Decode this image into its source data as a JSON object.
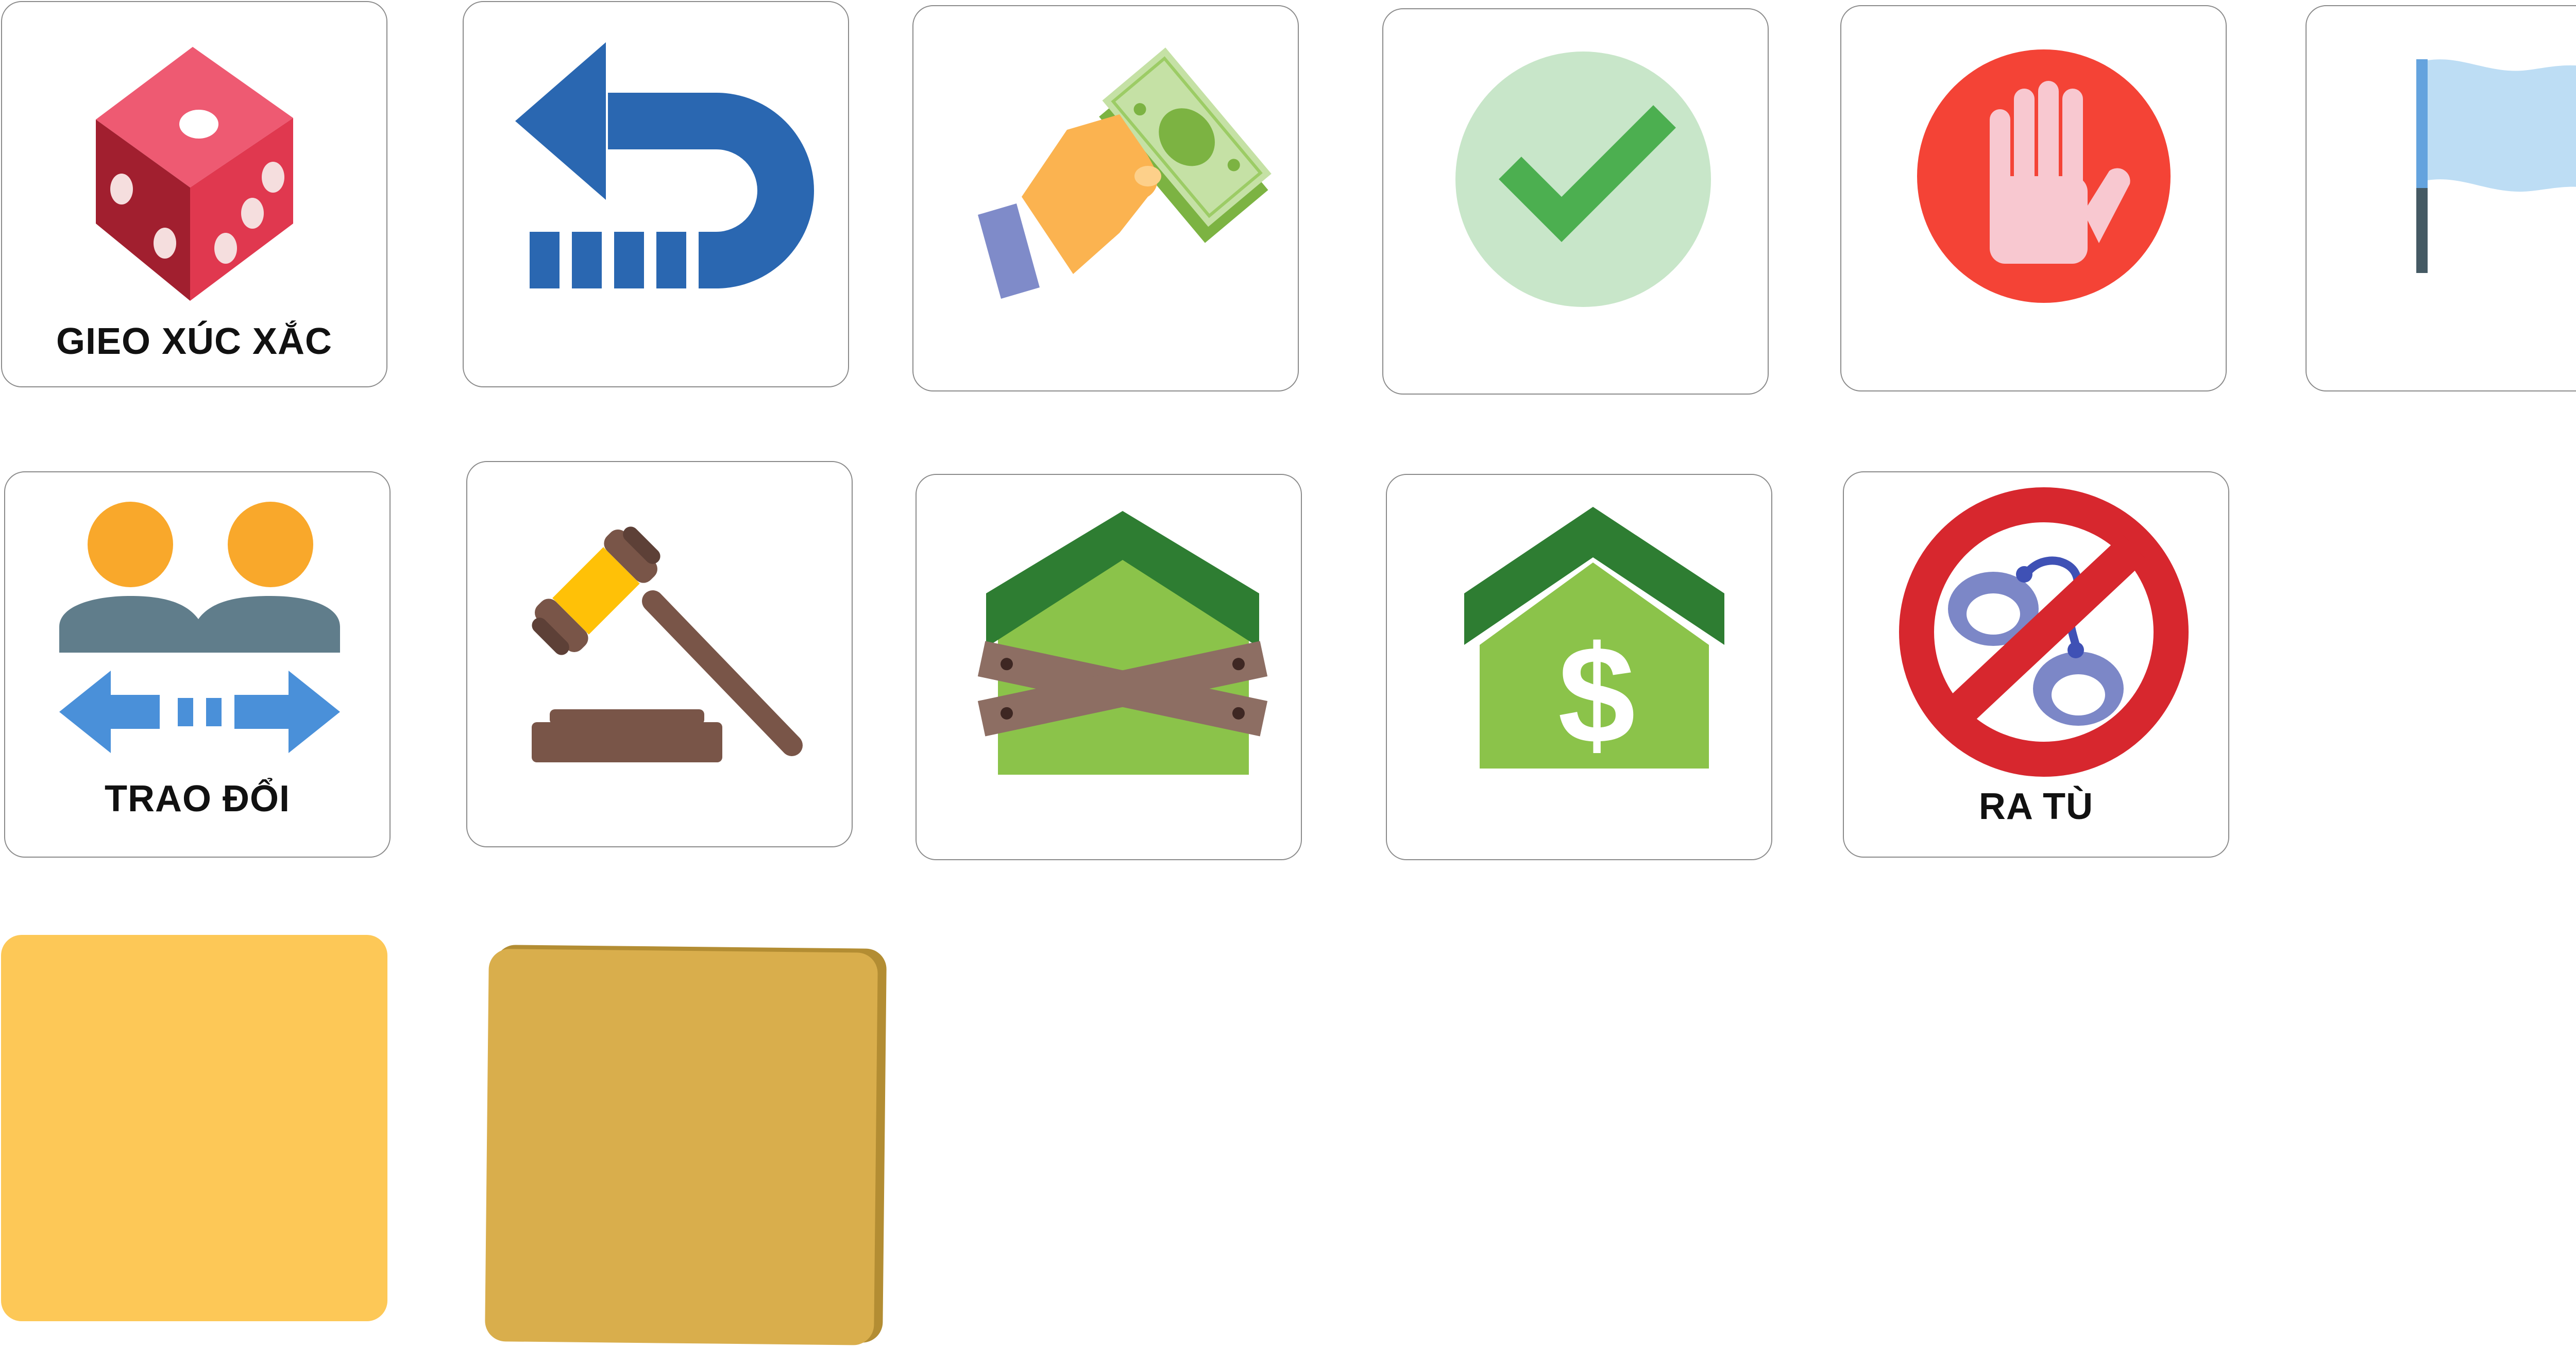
{
  "tiles": [
    {
      "id": "roll-dice",
      "label": "GIEO XÚC XẮC",
      "icon": "dice-icon"
    },
    {
      "id": "go-back",
      "label": "",
      "icon": "u-turn-back-arrow-icon"
    },
    {
      "id": "pay-money",
      "label": "",
      "icon": "hand-giving-money-icon"
    },
    {
      "id": "confirm",
      "label": "",
      "icon": "checkmark-icon"
    },
    {
      "id": "stop",
      "label": "",
      "icon": "stop-hand-icon"
    },
    {
      "id": "flag",
      "label": "",
      "icon": "flag-icon"
    },
    {
      "id": "trade",
      "label": "TRAO ĐỔI",
      "icon": "two-people-exchange-icon"
    },
    {
      "id": "auction",
      "label": "",
      "icon": "gavel-icon"
    },
    {
      "id": "mortgage",
      "label": "",
      "icon": "boarded-house-icon"
    },
    {
      "id": "sell-house",
      "label": "",
      "icon": "house-dollar-icon"
    },
    {
      "id": "leave-jail",
      "label": "RA TÙ",
      "icon": "no-handcuffs-icon"
    }
  ],
  "blank_cards": [
    {
      "id": "yellow-card",
      "color": "#FDC857"
    },
    {
      "id": "gold-card",
      "color": "#D9AE4C",
      "edge_color": "#B38D33"
    }
  ],
  "colors": {
    "border": "#8a8a8a",
    "label_text": "#111111",
    "dice_red": "#E0384F",
    "arrow_blue": "#2A67B1",
    "check_green": "#4CAF50",
    "stop_red": "#F44336",
    "flag_blue": "#BDDDF4",
    "house_green": "#8BC34A",
    "roof_green": "#2E7D32",
    "no_sign_red": "#D7272E",
    "cuffs_purple": "#7C87C7"
  }
}
